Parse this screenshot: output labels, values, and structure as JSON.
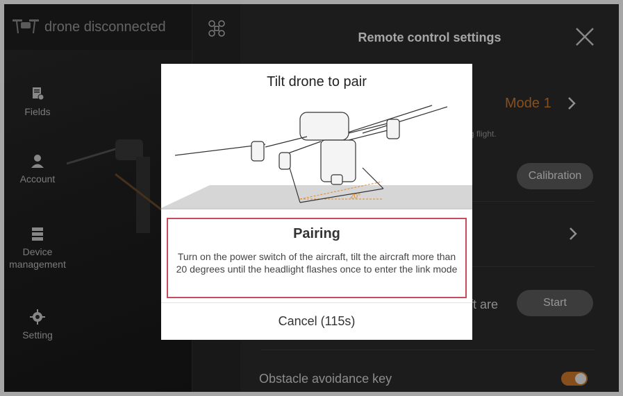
{
  "status": {
    "text": "drone disconnected"
  },
  "sidebar": {
    "items": [
      {
        "label": "Fields",
        "icon": "fields-icon"
      },
      {
        "label": "Account",
        "icon": "person-icon"
      },
      {
        "label": "Device management",
        "icon": "device-icon"
      },
      {
        "label": "Setting",
        "icon": "gear-icon"
      }
    ]
  },
  "panel": {
    "title": "Remote control settings",
    "mode_value": "Mode 1",
    "hint": "g flight.",
    "calibration_label": "Calibration",
    "pair_partial": "ft are",
    "start_label": "Start",
    "obstacle_label": "Obstacle avoidance key"
  },
  "modal": {
    "title": "Tilt drone to pair",
    "angle_label": "20°",
    "pairing_title": "Pairing",
    "pairing_desc": "Turn on the power switch of the aircraft, tilt the aircraft more than 20 degrees until the headlight flashes once to enter the link mode",
    "cancel_label": "Cancel   (115s)"
  },
  "colors": {
    "accent": "#d07a2c",
    "highlight_border": "#c84b5d",
    "panel_bg": "#2b2b2b"
  }
}
